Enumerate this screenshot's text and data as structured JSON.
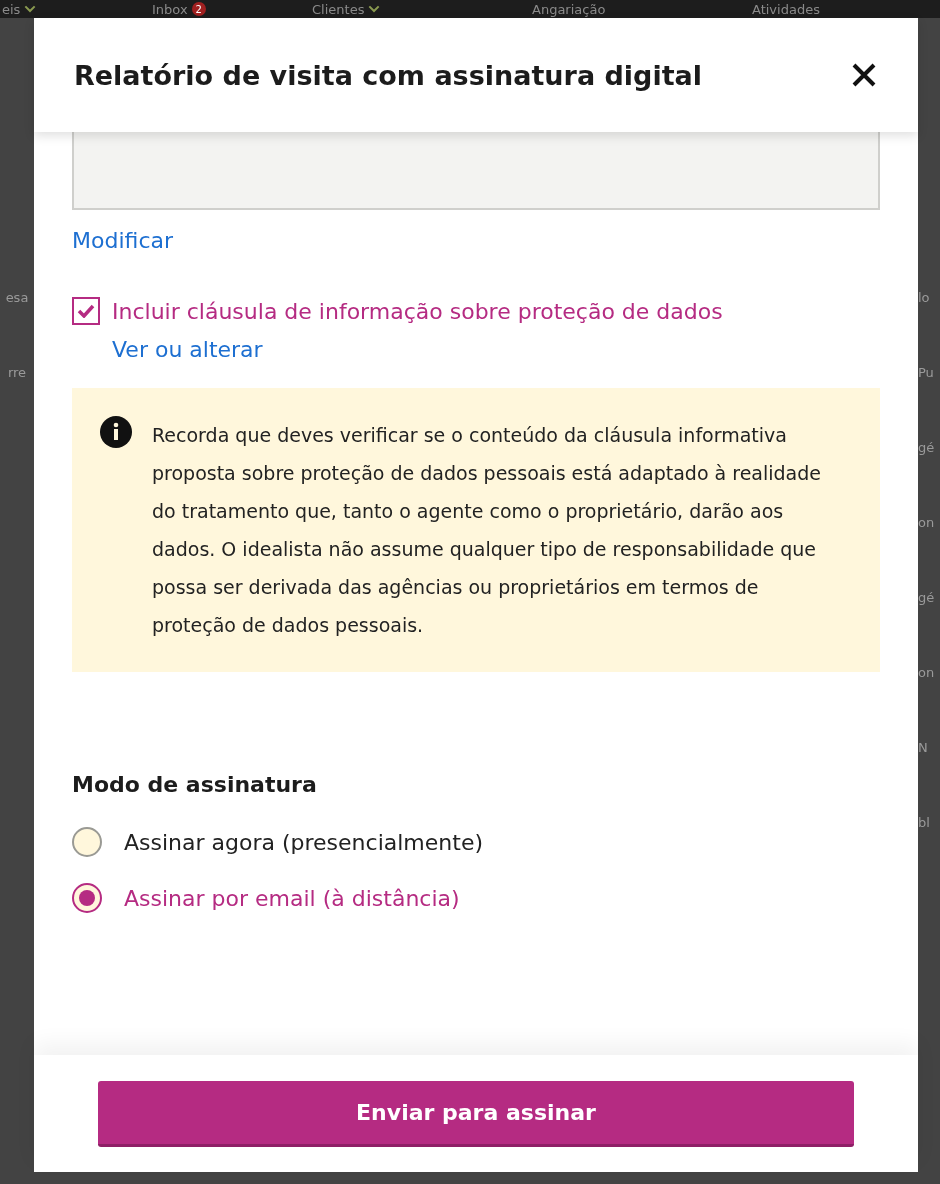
{
  "background_nav": [
    {
      "label": "eis",
      "caret": true
    },
    {
      "label": "Inbox",
      "badge": "2",
      "caret": false
    },
    {
      "label": "Clientes",
      "caret": true
    },
    {
      "label": "Angariação",
      "caret": false
    },
    {
      "label": "Atividades",
      "caret": false
    }
  ],
  "background_left": [
    "esa",
    "rre"
  ],
  "background_right": [
    "lo",
    "Pu",
    "gé",
    "on",
    "gé",
    "on",
    "N",
    "bl"
  ],
  "modal": {
    "title": "Relatório de visita com assinatura digital",
    "modify_link": "Modificar",
    "clause": {
      "label": "Incluir cláusula de informação sobre proteção de dados",
      "checked": true,
      "link": "Ver ou alterar"
    },
    "notice": "Recorda que deves verificar se o conteúdo da cláusula informativa proposta sobre proteção de dados pessoais está adaptado à realidade do tratamento que, tanto o agente como o proprietário, darão aos dados. O idealista não assume qualquer tipo de responsabilidade que possa ser derivada das agências ou proprietários em termos de proteção de dados pessoais.",
    "signature_mode": {
      "title": "Modo de assinatura",
      "options": [
        {
          "label": "Assinar agora (presencialmente)",
          "selected": false
        },
        {
          "label": "Assinar por email (à distância)",
          "selected": true
        }
      ]
    },
    "submit": "Enviar para assinar"
  }
}
